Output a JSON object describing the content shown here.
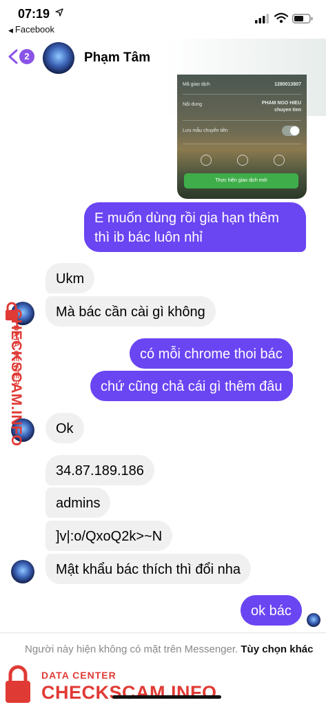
{
  "status_bar": {
    "time": "07:19",
    "back_app": "Facebook"
  },
  "header": {
    "back_badge": "2",
    "contact_name": "Phạm Tâm"
  },
  "shared_screenshot": {
    "rows": [
      {
        "label": "Mã giao dịch",
        "value": "1280013807"
      },
      {
        "label": "Nội dung",
        "value": "PHAM NGO HIEU\nchuyen tien"
      },
      {
        "label": "Lưu mẫu chuyển tiền",
        "value": ""
      }
    ],
    "button_label": "Thực hiện giao dịch mới"
  },
  "messages": [
    {
      "id": "m1",
      "direction": "out",
      "text_lines": [
        "E muốn dùng rồi gia hạn thêm",
        "thì ib bác luôn nhỉ"
      ]
    },
    {
      "id": "m2",
      "direction": "in",
      "text": "Ukm"
    },
    {
      "id": "m3",
      "direction": "in",
      "text": "Mà bác cần cài gì không"
    },
    {
      "id": "m4",
      "direction": "out",
      "text": "có mỗi chrome thoi bác"
    },
    {
      "id": "m5",
      "direction": "out",
      "text": "chứ cũng chả cái gì thêm đâu"
    },
    {
      "id": "m6",
      "direction": "in",
      "text": "Ok"
    },
    {
      "id": "m7",
      "direction": "in",
      "text": "34.87.189.186"
    },
    {
      "id": "m8",
      "direction": "in",
      "text": "admins"
    },
    {
      "id": "m9",
      "direction": "in",
      "text": "]v|:o/QxoQ2k>~N"
    },
    {
      "id": "m10",
      "direction": "in",
      "text": "Mật khẩu bác thích thì đổi nha"
    },
    {
      "id": "m11",
      "direction": "out",
      "text": "ok bác"
    }
  ],
  "footer": {
    "notice": "Người này hiện không có mặt trên Messenger.",
    "link": "Tùy chọn khác"
  },
  "watermark": {
    "small_text": "DATA CENTER",
    "big_text": "CHECKSCAM.INFO",
    "color": "#e03a35"
  },
  "colors": {
    "outgoing_bubble": "#6a45f2",
    "incoming_bubble": "#f0f0f0",
    "badge": "#8a54e8"
  }
}
